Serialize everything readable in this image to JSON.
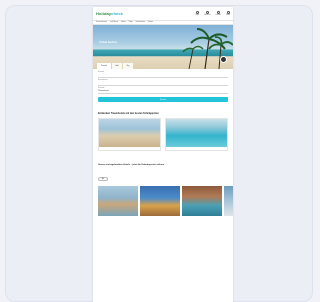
{
  "brand": {
    "logo_part1": "Holiday",
    "logo_part2": "check"
  },
  "top_icons": [
    {
      "icon": "user-icon",
      "label": "Login"
    },
    {
      "icon": "heart-icon",
      "label": "Merkliste"
    },
    {
      "icon": "phone-icon",
      "label": "Kontakt"
    },
    {
      "icon": "menu-icon",
      "label": "Menü"
    }
  ],
  "nav": [
    "Pauschalreisen",
    "Last Minute",
    "Hotels",
    "Flüge",
    "Ferienhäuser",
    "Reisen"
  ],
  "hero": {
    "title": "Urlaub buchen",
    "subtitle": "",
    "tabs": [
      "Pauschal",
      "Hotel",
      "Flug"
    ]
  },
  "search": {
    "fields": [
      {
        "label": "Reiseziel",
        "value": ""
      },
      {
        "label": "Reisezeitraum",
        "value": ""
      },
      {
        "label": "Reisende",
        "value": "2 Erwachsene"
      }
    ],
    "button": "Suchen",
    "more_link": ""
  },
  "section1_title": "Entdecken Traumhotels mit den besten Schnäppchen",
  "deals": [
    {
      "caption": "",
      "name": "",
      "sub": ""
    },
    {
      "caption": "",
      "name": "",
      "sub": ""
    }
  ],
  "section2_title": "Unsere meistgebuchten Hotels – jetzt die Urlaubspreise sichern",
  "filter_pill": "Alle",
  "hotels": [
    {
      "name": "",
      "loc": "",
      "price": ""
    },
    {
      "name": "",
      "loc": "",
      "price": ""
    },
    {
      "name": "",
      "loc": "",
      "price": ""
    },
    {
      "name": "",
      "loc": "",
      "price": ""
    }
  ],
  "colors": {
    "accent": "#23c3d9",
    "brand_green": "#2b8a3e",
    "deal_orange": "#e06a2a"
  }
}
